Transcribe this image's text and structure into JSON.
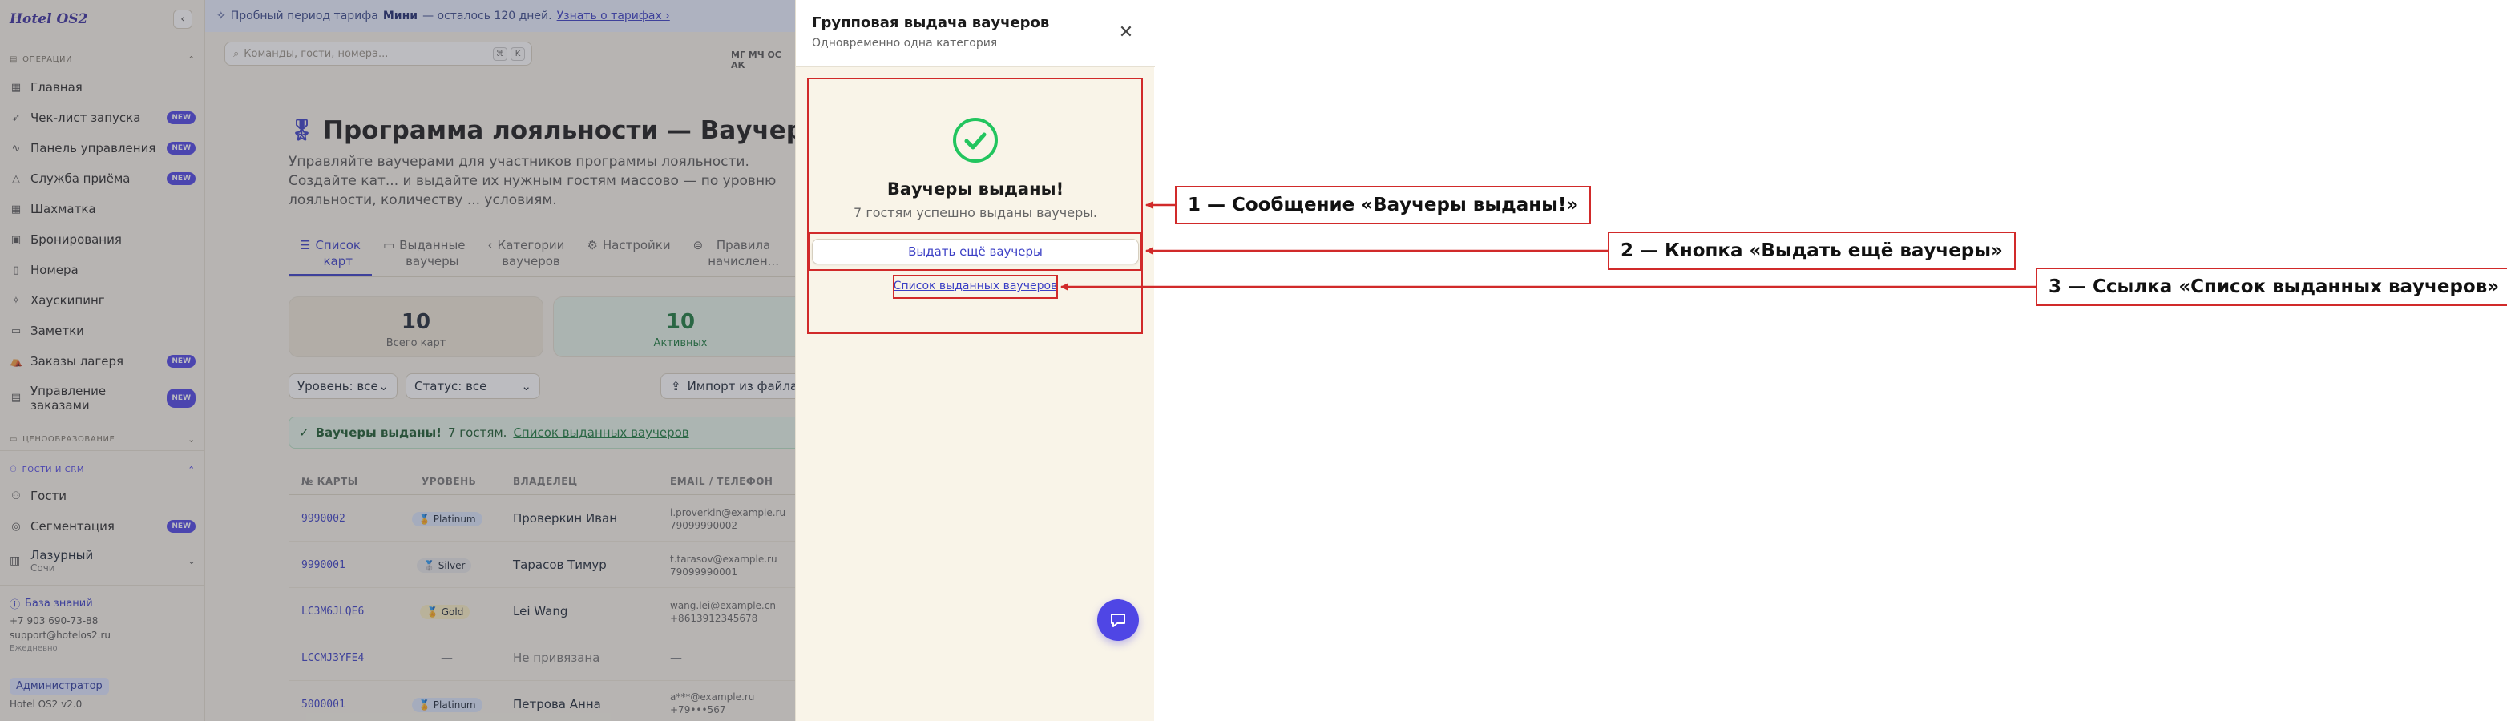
{
  "sidebar": {
    "brand": "Hotel OS2",
    "collapse_icon": "chevron-left-icon",
    "section_operations": "ОПЕРАЦИИ",
    "section_pricing": "ЦЕНООБРАЗОВАНИЕ",
    "section_guests": "ГОСТИ И CRM",
    "items": [
      {
        "label": "Главная",
        "icon": "grid-icon",
        "badge": ""
      },
      {
        "label": "Чек-лист запуска",
        "icon": "rocket-icon",
        "badge": "NEW"
      },
      {
        "label": "Панель управления",
        "icon": "activity-icon",
        "badge": "NEW"
      },
      {
        "label": "Служба приёма",
        "icon": "triangle-icon",
        "badge": "NEW"
      },
      {
        "label": "Шахматка",
        "icon": "table-icon",
        "badge": ""
      },
      {
        "label": "Бронирования",
        "icon": "calendar-icon",
        "badge": ""
      },
      {
        "label": "Номера",
        "icon": "door-icon",
        "badge": ""
      },
      {
        "label": "Хаускипинг",
        "icon": "sparkle-icon",
        "badge": ""
      },
      {
        "label": "Заметки",
        "icon": "note-icon",
        "badge": ""
      },
      {
        "label": "Заказы лагеря",
        "icon": "tent-icon",
        "badge": "NEW"
      },
      {
        "label": "Управление заказами",
        "icon": "clipboard-icon",
        "badge": "NEW"
      }
    ],
    "guest_items": [
      {
        "label": "Гости",
        "icon": "users-icon",
        "badge": ""
      },
      {
        "label": "Сегментация",
        "icon": "target-icon",
        "badge": "NEW"
      }
    ],
    "property_name": "Лазурный",
    "property_city": "Сочи",
    "knowledge_base": "База знаний",
    "phone": "+7 903 690-73-88",
    "email": "support@hotelos2.ru",
    "schedule": "Ежедневно",
    "role": "Администратор",
    "version": "Hotel OS2 v2.0"
  },
  "main": {
    "banner": {
      "prefix": "Пробный период тарифа",
      "plan": "Мини",
      "suffix": "— осталось 120 дней.",
      "link": "Узнать о тарифах ›"
    },
    "search_placeholder": "Команды, гости, номера...",
    "kbd1": "⌘",
    "kbd2": "K",
    "timezone": "МГ МЧ ОС АК",
    "title": "Программа лояльности — Ваучеры",
    "description": "Управляйте ваучерами для участников программы лояльности. Создайте кат... и выдайте их нужным гостям массово — по уровню лояльности, количеству ... условиям.",
    "tabs": [
      {
        "line1": "Список",
        "line2": "карт",
        "icon": "list-icon"
      },
      {
        "line1": "Выданные",
        "line2": "ваучеры",
        "icon": "ticket-icon"
      },
      {
        "line1": "Категории",
        "line2": "ваучеров",
        "icon": "tag-icon"
      },
      {
        "line1": "Настройки",
        "line2": "",
        "icon": "gear-icon"
      },
      {
        "line1": "Правила",
        "line2": "начислен...",
        "icon": "rule-icon"
      }
    ],
    "stats": [
      {
        "value": "10",
        "label": "Всего карт"
      },
      {
        "value": "10",
        "label": "Активных"
      }
    ],
    "filter_level": "Уровень: все",
    "filter_status": "Статус: все",
    "import_label": "Импорт из файла",
    "alert": {
      "strong": "Ваучеры выданы!",
      "text": "7 гостям.",
      "link": "Список выданных ваучеров"
    },
    "columns": [
      "№ КАРТЫ",
      "УРОВЕНЬ",
      "ВЛАДЕЛЕЦ",
      "EMAIL / ТЕЛЕФОН"
    ],
    "rows": [
      {
        "card": "9990002",
        "level": "🏅 Platinum",
        "owner": "Проверкин Иван",
        "email": "i.proverkin@example.ru",
        "phone": "79099990002"
      },
      {
        "card": "9990001",
        "level": "🥈 Silver",
        "owner": "Тарасов Тимур",
        "email": "t.tarasov@example.ru",
        "phone": "79099990001"
      },
      {
        "card": "LC3M6JLQE6",
        "level": "🏅 Gold",
        "owner": "Lei Wang",
        "email": "wang.lei@example.cn",
        "phone": "+8613912345678"
      },
      {
        "card": "LCCMJ3YFE4",
        "level": "—",
        "owner": "Не привязана",
        "email": "—",
        "phone": ""
      },
      {
        "card": "5000001",
        "level": "🏅 Platinum",
        "owner": "Петрова Анна",
        "email": "a***@example.ru",
        "phone": "+79•••567"
      }
    ]
  },
  "drawer": {
    "title": "Групповая выдача ваучеров",
    "subtitle": "Одновременно одна категория",
    "close_icon": "close-icon",
    "success_icon": "check-circle-icon",
    "success_title": "Ваучеры выданы!",
    "success_text": "7 гостям успешно выданы ваучеры.",
    "more_button": "Выдать ещё ваучеры",
    "list_link": "Список выданных ваучеров",
    "chat_icon": "chat-icon"
  },
  "annotations": [
    {
      "label": "1 — Сообщение «Ваучеры выданы!»"
    },
    {
      "label": "2 — Кнопка «Выдать ещё ваучеры»"
    },
    {
      "label": "3 — Ссылка «Список выданных ваучеров»"
    }
  ],
  "colors": {
    "accent": "#4f46e5",
    "success": "#22c55e",
    "annotation": "#d12a2a",
    "background": "#f7f3ea"
  }
}
